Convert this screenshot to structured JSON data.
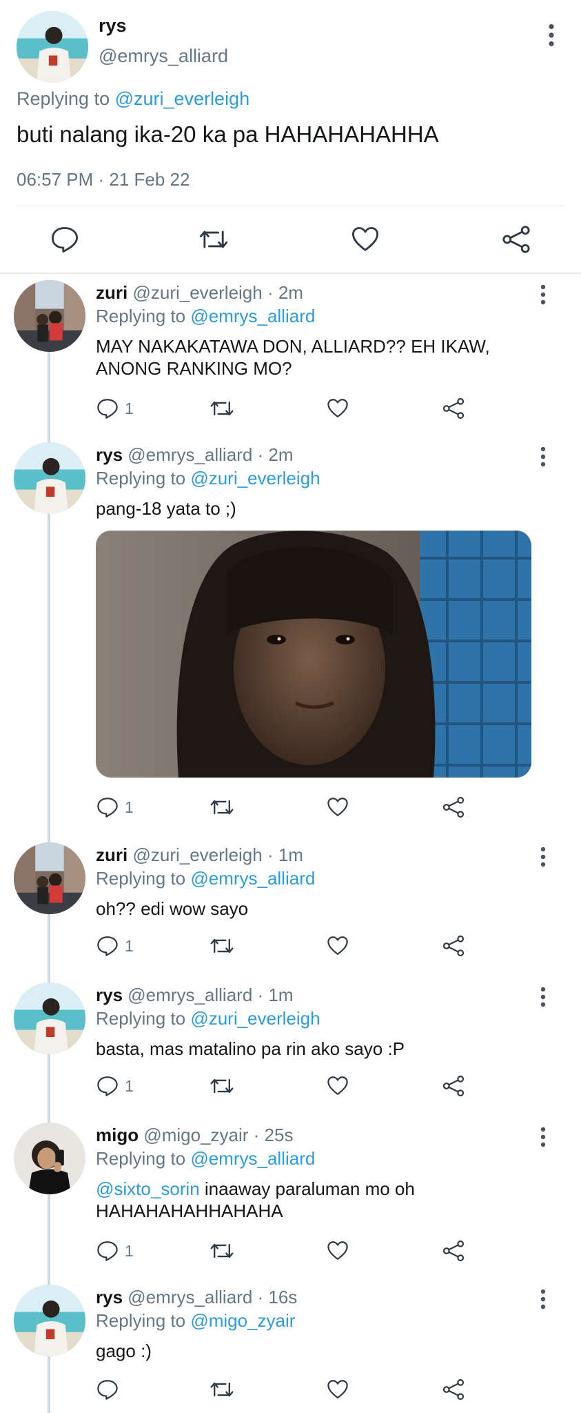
{
  "main_tweet": {
    "name": "rys",
    "handle": "@emrys_alliard",
    "replying_prefix": "Replying to ",
    "replying_to": "@zuri_everleigh",
    "text": "buti nalang ika-20 ka pa HAHAHAHAHHA",
    "timestamp": "06:57 PM · 21 Feb 22"
  },
  "replies": [
    {
      "name": "zuri",
      "handle": "@zuri_everleigh",
      "time": " · 2m",
      "replying_prefix": "Replying to ",
      "replying_to": "@emrys_alliard",
      "text": "MAY NAKAKATAWA DON, ALLIARD?? EH IKAW, ANONG RANKING MO?",
      "reply_count": "1"
    },
    {
      "name": "rys",
      "handle": "@emrys_alliard",
      "time": " · 2m",
      "replying_prefix": "Replying to ",
      "replying_to": "@zuri_everleigh",
      "text": "pang-18 yata to ;)",
      "reply_count": "1"
    },
    {
      "name": "zuri",
      "handle": "@zuri_everleigh",
      "time": " · 1m",
      "replying_prefix": "Replying to ",
      "replying_to": "@emrys_alliard",
      "text": "oh?? edi wow sayo",
      "reply_count": "1"
    },
    {
      "name": "rys",
      "handle": "@emrys_alliard",
      "time": " · 1m",
      "replying_prefix": "Replying to ",
      "replying_to": "@zuri_everleigh",
      "text": "basta, mas matalino pa rin ako sayo :P",
      "reply_count": "1"
    },
    {
      "name": "migo",
      "handle": "@migo_zyair",
      "time": " · 25s",
      "replying_prefix": "Replying to ",
      "replying_to": "@emrys_alliard",
      "mention": "@sixto_sorin",
      "text": " inaaway paraluman mo oh HAHAHAHAHHAHAHA",
      "reply_count": "1"
    },
    {
      "name": "rys",
      "handle": "@emrys_alliard",
      "time": " · 16s",
      "replying_prefix": "Replying to ",
      "replying_to": "@migo_zyair",
      "text": "gago :)",
      "reply_count": ""
    }
  ],
  "colors": {
    "link": "#2b9ce0",
    "muted": "#657786",
    "text": "#14171a"
  },
  "icons": [
    "reply-icon",
    "retweet-icon",
    "like-icon",
    "share-icon",
    "more-icon"
  ]
}
